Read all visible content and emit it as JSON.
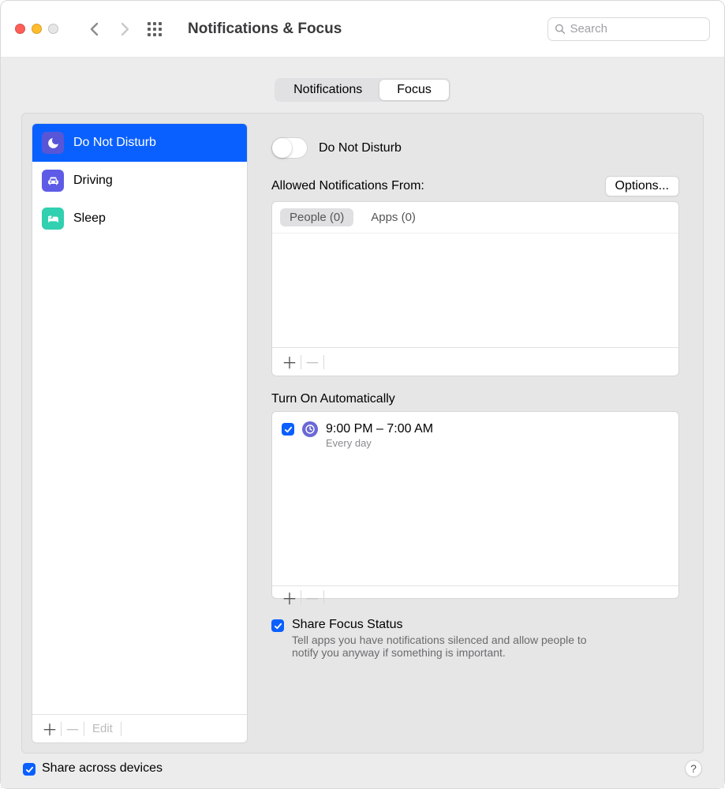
{
  "header": {
    "title": "Notifications & Focus",
    "search_placeholder": "Search"
  },
  "tabs": {
    "notifications": "Notifications",
    "focus": "Focus"
  },
  "sidebar": {
    "items": [
      {
        "label": "Do Not Disturb"
      },
      {
        "label": "Driving"
      },
      {
        "label": "Sleep"
      }
    ],
    "edit_label": "Edit"
  },
  "detail": {
    "toggle_label": "Do Not Disturb",
    "allowed_label": "Allowed Notifications From:",
    "options_label": "Options...",
    "people_tab": "People (0)",
    "apps_tab": "Apps (0)",
    "turn_on_label": "Turn On Automatically",
    "schedule": {
      "time": "9:00 PM – 7:00 AM",
      "repeat": "Every day"
    },
    "share_status_label": "Share Focus Status",
    "share_status_desc": "Tell apps you have notifications silenced and allow people to notify you anyway if something is important."
  },
  "bottom": {
    "share_devices_label": "Share across devices",
    "help": "?"
  }
}
